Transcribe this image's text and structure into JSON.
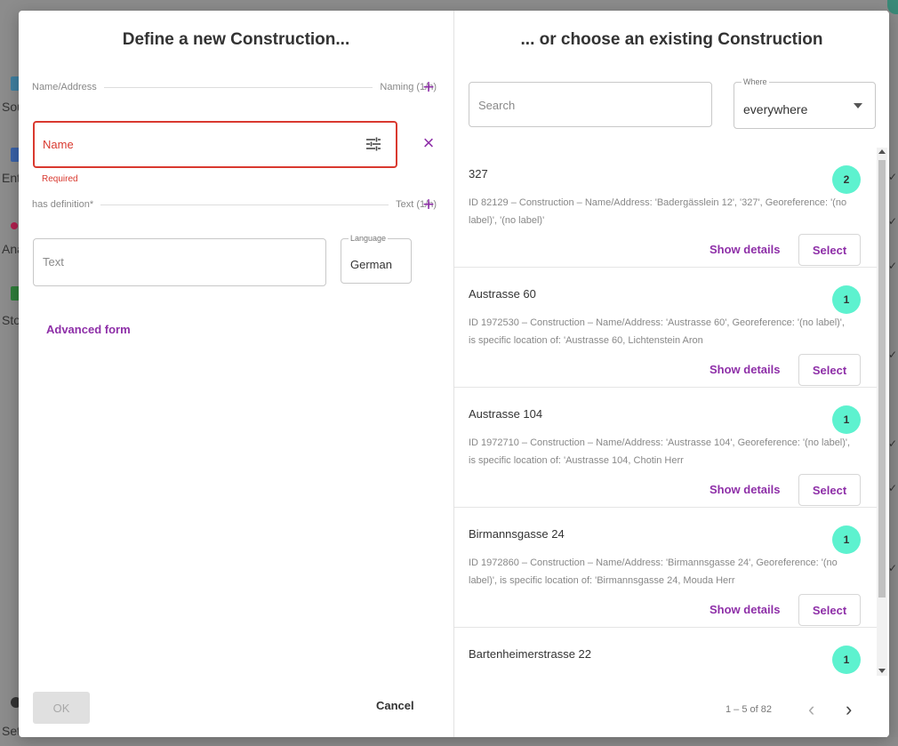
{
  "background": {
    "nav_fragments": [
      "Sou",
      "Ent",
      "Ana",
      "Sto",
      "Set"
    ]
  },
  "left_pane": {
    "title": "Define a new Construction...",
    "naming_section": {
      "label": "Name/Address",
      "count": "Naming (1/n)"
    },
    "name_field": {
      "placeholder": "Name",
      "error": "Required"
    },
    "definition_section": {
      "label": "has definition*",
      "count": "Text (1/n)"
    },
    "text_field": {
      "placeholder": "Text"
    },
    "language_field": {
      "legend": "Language",
      "value": "German"
    },
    "advanced_link": "Advanced form",
    "ok_label": "OK",
    "cancel_label": "Cancel"
  },
  "right_pane": {
    "title": "... or choose an existing Construction",
    "search": {
      "placeholder": "Search"
    },
    "where": {
      "legend": "Where",
      "value": "everywhere"
    },
    "results": [
      {
        "title": "327",
        "badge": "2",
        "description": "ID 82129 – Construction – Name/Address: 'Badergässlein 12', '327', Georeference: '(no label)', '(no label)'",
        "details_label": "Show details",
        "select_label": "Select"
      },
      {
        "title": "Austrasse 60",
        "badge": "1",
        "description": "ID 1972530 – Construction – Name/Address: 'Austrasse 60', Georeference: '(no label)', is specific location of: 'Austrasse 60, Lichtenstein Aron",
        "details_label": "Show details",
        "select_label": "Select"
      },
      {
        "title": "Austrasse 104",
        "badge": "1",
        "description": "ID 1972710 – Construction – Name/Address: 'Austrasse 104', Georeference: '(no label)', is specific location of: 'Austrasse 104, Chotin Herr",
        "details_label": "Show details",
        "select_label": "Select"
      },
      {
        "title": "Birmannsgasse 24",
        "badge": "1",
        "description": "ID 1972860 – Construction – Name/Address: 'Birmannsgasse 24', Georeference: '(no label)', is specific location of: 'Birmannsgasse 24, Mouda Herr",
        "details_label": "Show details",
        "select_label": "Select"
      },
      {
        "title": "Bartenheimerstrasse 22",
        "badge": "1",
        "description": "",
        "details_label": "",
        "select_label": ""
      }
    ],
    "pager": {
      "text": "1 – 5 of 82"
    }
  },
  "colors": {
    "accent": "#8e2fa8",
    "error": "#d9392f",
    "badge": "#5df2cf"
  }
}
